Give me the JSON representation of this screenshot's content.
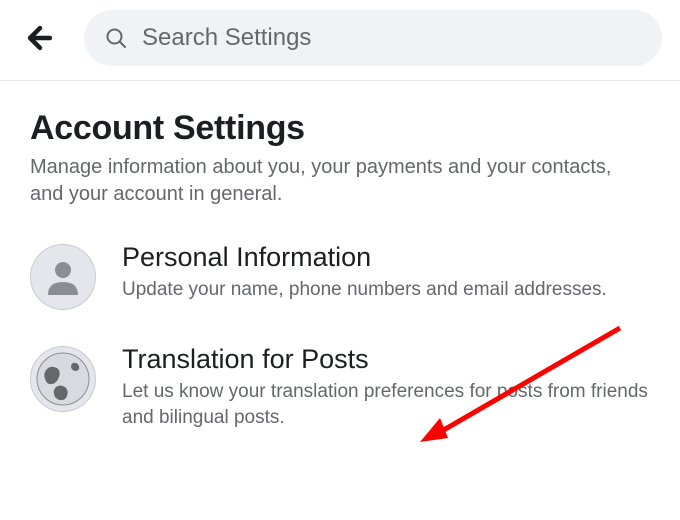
{
  "header": {
    "search_placeholder": "Search Settings"
  },
  "page": {
    "title": "Account Settings",
    "subtitle": "Manage information about you, your payments and your contacts, and your account in general."
  },
  "settings": [
    {
      "icon": "person-icon",
      "title": "Personal Information",
      "desc": "Update your name, phone numbers and email addresses."
    },
    {
      "icon": "globe-icon",
      "title": "Translation for Posts",
      "desc": "Let us know your translation preferences for posts from friends and bilingual posts."
    }
  ]
}
